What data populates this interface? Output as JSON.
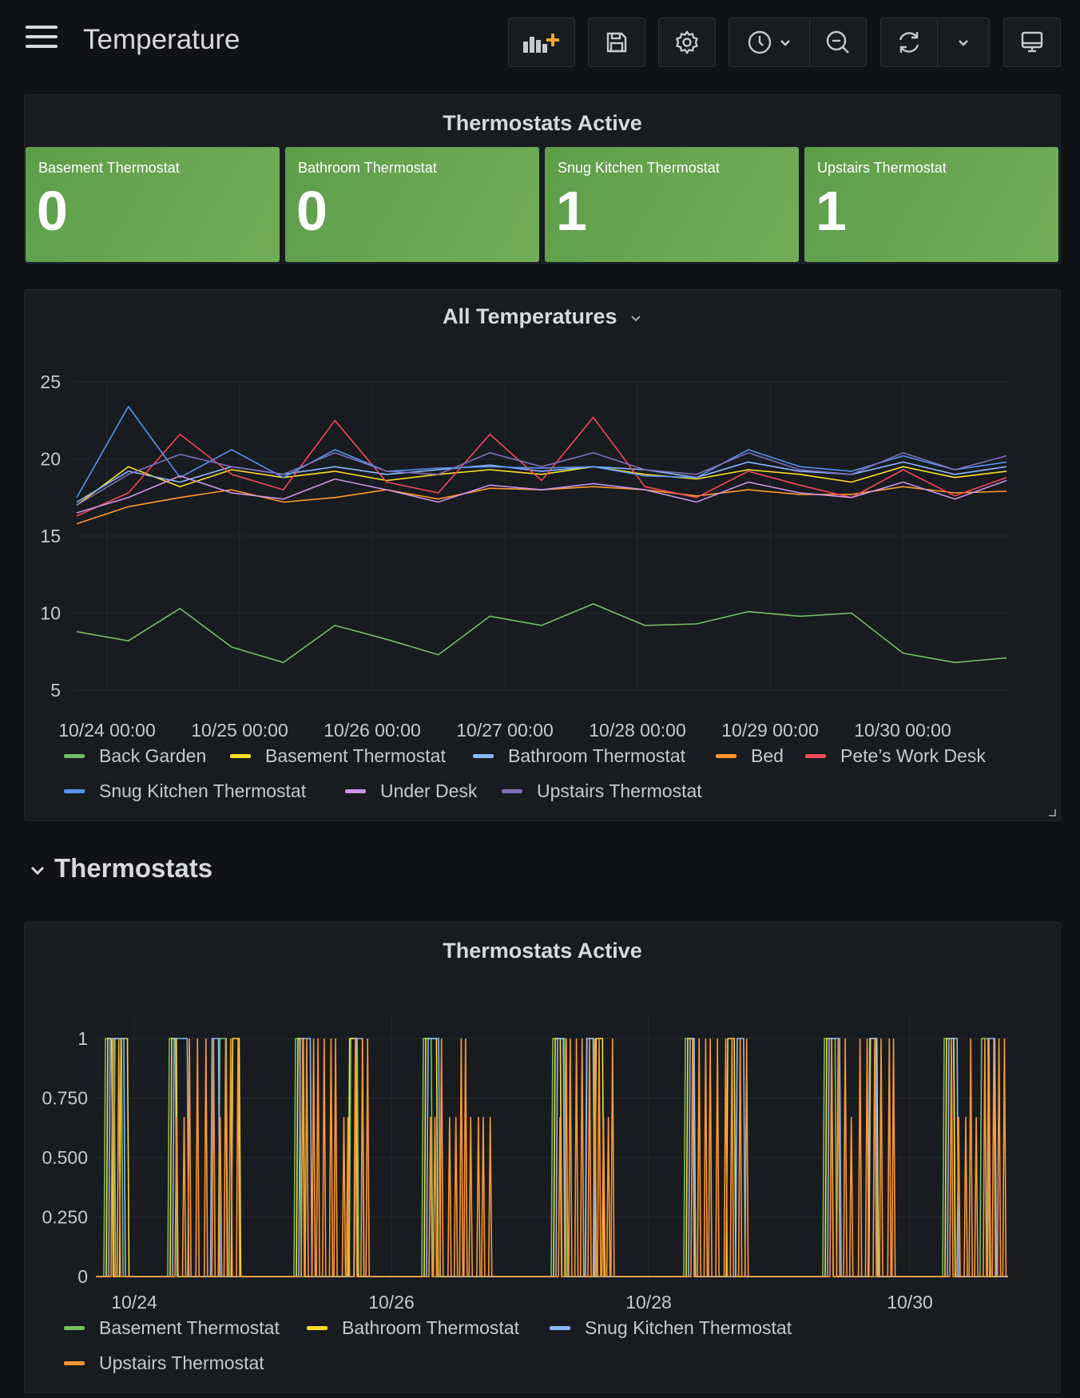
{
  "dashboard": {
    "title": "Temperature"
  },
  "toolbar": {
    "buttons": [
      {
        "name": "add-panel",
        "icon": "add-panel-icon"
      },
      {
        "name": "save",
        "icon": "save-icon"
      },
      {
        "name": "settings",
        "icon": "gear-icon"
      },
      {
        "name": "time-picker",
        "icon": "clock-icon"
      },
      {
        "name": "zoom-out",
        "icon": "zoom-out-icon"
      },
      {
        "name": "refresh",
        "icon": "refresh-icon"
      },
      {
        "name": "refresh-interval",
        "icon": "chevron-down-icon"
      },
      {
        "name": "tv-mode",
        "icon": "monitor-icon"
      }
    ],
    "accent": "#f5a623"
  },
  "stats_panel": {
    "title": "Thermostats Active",
    "color": "#73ad58",
    "items": [
      {
        "label": "Basement Thermostat",
        "value": "0"
      },
      {
        "label": "Bathroom Thermostat",
        "value": "0"
      },
      {
        "label": "Snug Kitchen Thermostat",
        "value": "1"
      },
      {
        "label": "Upstairs Thermostat",
        "value": "1"
      }
    ]
  },
  "temps_panel": {
    "title": "All Temperatures"
  },
  "row": {
    "title": "Thermostats"
  },
  "active_panel": {
    "title": "Thermostats Active"
  },
  "chart_data": [
    {
      "type": "line",
      "title": "All Temperatures",
      "ylim": [
        5,
        25
      ],
      "yticks": [
        "5",
        "10",
        "15",
        "20",
        "25"
      ],
      "xticks": [
        "10/24 00:00",
        "10/25 00:00",
        "10/26 00:00",
        "10/27 00:00",
        "10/28 00:00",
        "10/29 00:00",
        "10/30 00:00"
      ],
      "x_hours": [
        0,
        12,
        24,
        36,
        48,
        60,
        72,
        84,
        96,
        108,
        120,
        132,
        144,
        156,
        164
      ],
      "x_start_hour": -3,
      "grid": true,
      "legend": "bottom",
      "series": [
        {
          "name": "Back Garden",
          "color": "#73bf69",
          "values": [
            8.8,
            8.2,
            10.3,
            7.8,
            6.8,
            9.2,
            8.3,
            7.3,
            9.8,
            9.2,
            10.6,
            9.2,
            9.3,
            10.1,
            9.8,
            10.0,
            7.4,
            6.8,
            7.1
          ]
        },
        {
          "name": "Basement Thermostat",
          "color": "#fade2a",
          "values": [
            17.0,
            19.5,
            18.2,
            19.3,
            18.8,
            19.2,
            18.6,
            19.0,
            19.3,
            19.0,
            19.5,
            19.0,
            18.7,
            19.3,
            19.0,
            18.5,
            19.5,
            18.8,
            19.2
          ]
        },
        {
          "name": "Bathroom Thermostat",
          "color": "#8ab8ff",
          "values": [
            17.2,
            19.2,
            18.5,
            19.5,
            19.0,
            19.5,
            19.0,
            19.3,
            19.6,
            19.2,
            19.5,
            19.3,
            18.8,
            19.8,
            19.2,
            19.0,
            19.8,
            19.0,
            19.5
          ]
        },
        {
          "name": "Bed",
          "color": "#ff9830",
          "values": [
            15.8,
            16.9,
            17.5,
            18.0,
            17.2,
            17.5,
            18.0,
            17.4,
            18.1,
            18.0,
            18.2,
            18.0,
            17.6,
            18.0,
            17.7,
            17.7,
            18.2,
            17.8,
            17.9
          ]
        },
        {
          "name": "Pete’s Work Desk",
          "color": "#f2495c",
          "values": [
            16.3,
            17.8,
            21.6,
            19.0,
            18.0,
            22.5,
            18.5,
            17.8,
            21.6,
            18.6,
            22.7,
            18.2,
            17.5,
            19.2,
            18.3,
            17.5,
            19.3,
            17.6,
            18.8
          ]
        },
        {
          "name": "Snug Kitchen Thermostat",
          "color": "#5794f2",
          "values": [
            17.5,
            23.4,
            18.8,
            20.6,
            18.8,
            20.6,
            19.2,
            19.4,
            19.5,
            19.4,
            19.5,
            18.9,
            18.8,
            20.6,
            19.5,
            19.2,
            20.2,
            19.3,
            19.8
          ]
        },
        {
          "name": "Under Desk",
          "color": "#ca95e5",
          "values": [
            16.5,
            17.5,
            18.9,
            17.8,
            17.4,
            18.7,
            18.0,
            17.2,
            18.3,
            18.0,
            18.4,
            18.0,
            17.2,
            18.5,
            17.8,
            17.5,
            18.5,
            17.4,
            18.6
          ]
        },
        {
          "name": "Upstairs Thermostat",
          "color": "#806eb7",
          "values": [
            17.0,
            19.0,
            20.3,
            19.5,
            19.0,
            20.4,
            19.2,
            19.0,
            20.4,
            19.5,
            20.4,
            19.3,
            19.0,
            20.4,
            19.3,
            19.0,
            20.4,
            19.3,
            20.2
          ]
        }
      ]
    },
    {
      "type": "line",
      "title": "Thermostats Active",
      "ylim": [
        0,
        1
      ],
      "yticks": [
        "0",
        "0.250",
        "0.500",
        "0.750",
        "1"
      ],
      "xticks": [
        "10/24",
        "10/26",
        "10/28",
        "10/30"
      ],
      "grid": true,
      "legend": "bottom",
      "series": [
        {
          "name": "Basement Thermostat",
          "color": "#73bf69"
        },
        {
          "name": "Bathroom Thermostat",
          "color": "#fade2a"
        },
        {
          "name": "Snug Kitchen Thermostat",
          "color": "#8ab8ff"
        },
        {
          "name": "Upstairs Thermostat",
          "color": "#ff9830"
        }
      ]
    }
  ]
}
